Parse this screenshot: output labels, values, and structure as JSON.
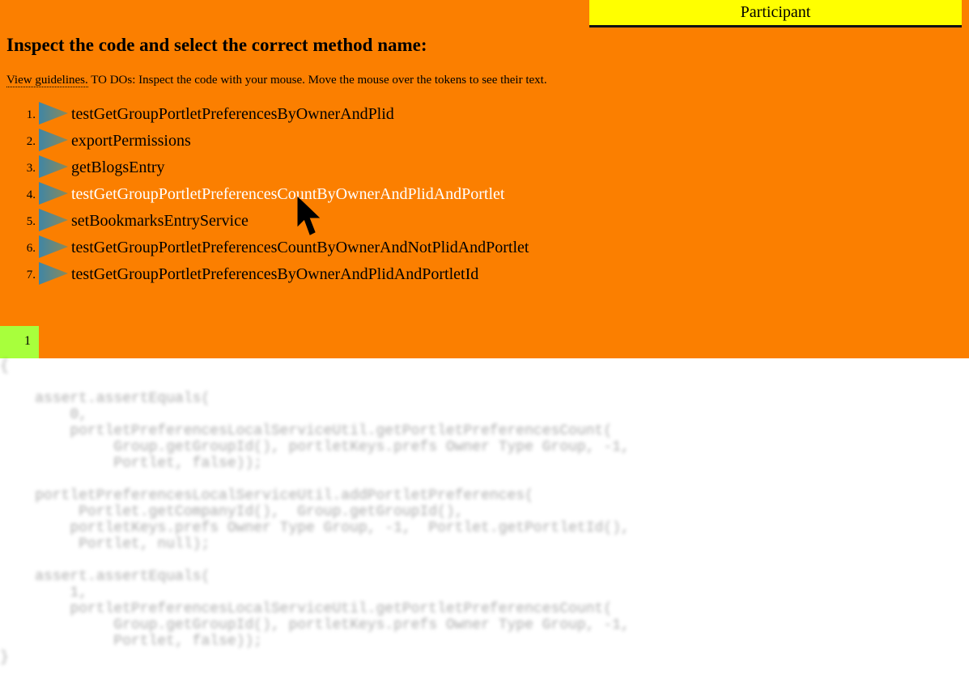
{
  "header": {
    "participant_label": "Participant"
  },
  "page": {
    "title": "Inspect the code and select the correct method name:",
    "guidelines_link": "View guidelines.",
    "instructions": " TO DOs: Inspect the code with your mouse. Move the mouse over the tokens to see their text."
  },
  "options": [
    {
      "number": "1.",
      "label": "testGetGroupPortletPreferencesByOwnerAndPlid"
    },
    {
      "number": "2.",
      "label": "exportPermissions"
    },
    {
      "number": "3.",
      "label": "getBlogsEntry"
    },
    {
      "number": "4.",
      "label": "testGetGroupPortletPreferencesCountByOwnerAndPlidAndPortlet"
    },
    {
      "number": "5.",
      "label": "setBookmarksEntryService"
    },
    {
      "number": "6.",
      "label": "testGetGroupPortletPreferencesCountByOwnerAndNotPlidAndPortlet"
    },
    {
      "number": "7.",
      "label": "testGetGroupPortletPreferencesByOwnerAndPlidAndPortletId"
    }
  ],
  "code": {
    "line_number": "1",
    "text": "{\n\n    assert.assertEquals(\n        0,\n        portletPreferencesLocalServiceUtil.getPortletPreferencesCount(\n             Group.getGroupId(), portletKeys.prefs Owner Type Group, -1,\n             Portlet, false));\n\n    portletPreferencesLocalServiceUtil.addPortletPreferences(\n         Portlet.getCompanyId(),  Group.getGroupId(),\n        portletKeys.prefs Owner Type Group, -1,  Portlet.getPortletId(),\n         Portlet, null);\n\n    assert.assertEquals(\n        1,\n        portletPreferencesLocalServiceUtil.getPortletPreferencesCount(\n             Group.getGroupId(), portletKeys.prefs Owner Type Group, -1,\n             Portlet, false));\n}"
  },
  "colors": {
    "background_top": "#fb7f00",
    "participant_bar": "#ffff00",
    "line_number_bg": "#a8ff3c",
    "hover_text": "#ffffff"
  },
  "icons": {
    "option_icon": "play-triangle-icon",
    "pointer": "mouse-cursor-icon"
  }
}
